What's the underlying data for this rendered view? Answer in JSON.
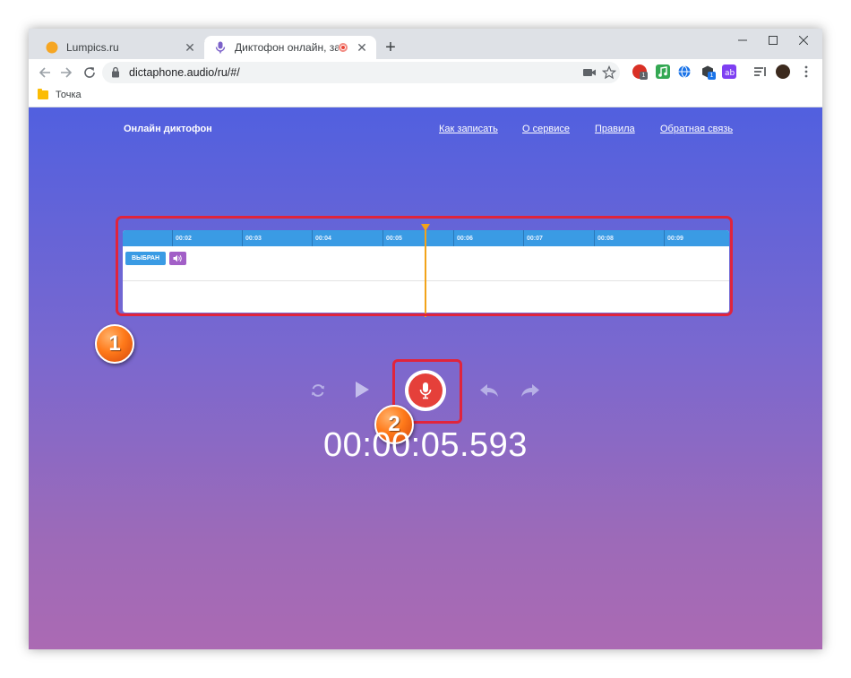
{
  "browser": {
    "tabs": [
      {
        "title": "Lumpics.ru",
        "active": false,
        "favicon": "orange-circle-icon"
      },
      {
        "title": "Диктофон онлайн, записать",
        "active": true,
        "favicon": "microphone-icon",
        "recording": true
      }
    ],
    "new_tab_label": "+",
    "url": "dictaphone.audio/ru/#/",
    "bookmarks": [
      {
        "label": "Точка"
      }
    ],
    "window_controls": [
      "minimize-icon",
      "maximize-icon",
      "close-icon"
    ]
  },
  "site": {
    "brand": "Онлайн диктофон",
    "nav": [
      {
        "label": "Как записать"
      },
      {
        "label": "О сервисе"
      },
      {
        "label": "Правила"
      },
      {
        "label": "Обратная связь"
      }
    ]
  },
  "timeline": {
    "ticks": [
      "00:02",
      "00:03",
      "00:04",
      "00:05",
      "00:06",
      "00:07",
      "00:08",
      "00:09"
    ],
    "track": {
      "select_label": "ВЫБРАН",
      "volume_icon": "speaker-icon"
    },
    "playhead_time": "00:05"
  },
  "controls": {
    "buttons": [
      "refresh-icon",
      "play-icon",
      "microphone-icon",
      "undo-icon",
      "redo-icon"
    ]
  },
  "timer": "00:00:05.593",
  "callouts": [
    "1",
    "2"
  ],
  "colors": {
    "accent_red": "#e0243c",
    "record_red": "#e5403a",
    "ruler_blue": "#3a9be4",
    "playhead": "#f2a31a",
    "volume_purple": "#a25fc7"
  }
}
